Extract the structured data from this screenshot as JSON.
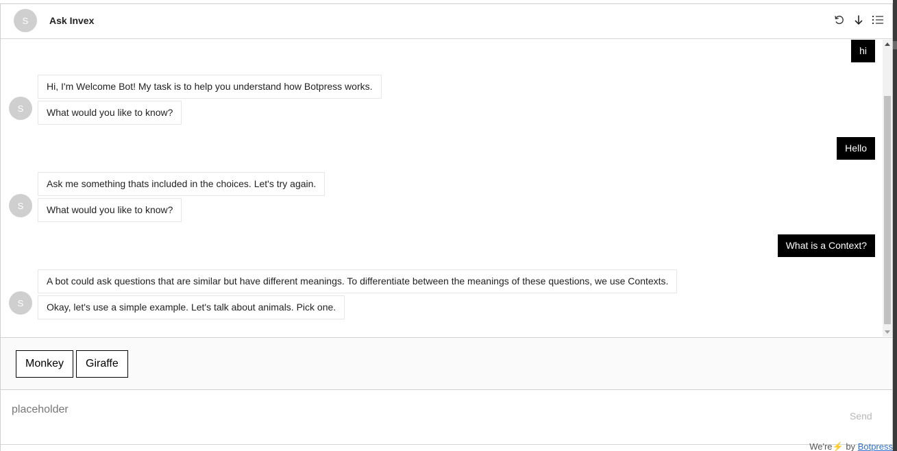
{
  "header": {
    "avatar_letter": "S",
    "title": "Ask Invex",
    "icons": [
      "reset-icon",
      "download-icon",
      "list-icon"
    ]
  },
  "messages": [
    {
      "from": "user",
      "text": "hi"
    },
    {
      "from": "bot",
      "avatar_letter": "S",
      "bubbles": [
        "Hi, I'm Welcome Bot! My task is to help you understand how Botpress works.",
        "What would you like to know?"
      ]
    },
    {
      "from": "user",
      "text": "Hello"
    },
    {
      "from": "bot",
      "avatar_letter": "S",
      "bubbles": [
        "Ask me something thats included in the choices. Let's try again.",
        "What would you like to know?"
      ]
    },
    {
      "from": "user",
      "text": "What is a Context?"
    },
    {
      "from": "bot",
      "avatar_letter": "S",
      "bubbles": [
        "A bot could ask questions that are similar but have different meanings. To differentiate between the meanings of these questions, we use Contexts.",
        "Okay, let's use a simple example. Let's talk about animals. Pick one."
      ]
    }
  ],
  "quick_replies": [
    "Monkey",
    "Giraffe"
  ],
  "composer": {
    "placeholder": "placeholder",
    "send_label": "Send"
  },
  "footer": {
    "prefix": "We're",
    "bolt": "⚡",
    "by": "by",
    "link_text": "Botpress"
  },
  "colors": {
    "user_bubble_bg": "#000000",
    "user_bubble_text": "#ffffff",
    "avatar_bg": "#cfcfcf",
    "link": "#2d6fc9"
  }
}
